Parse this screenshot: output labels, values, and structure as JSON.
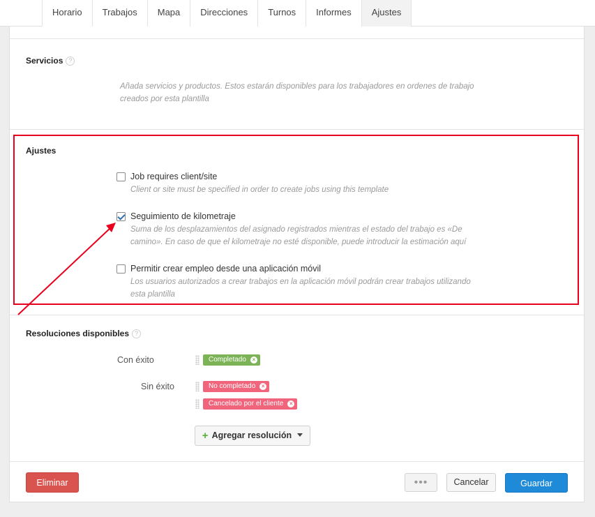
{
  "nav": {
    "tabs": [
      {
        "label": "Horario"
      },
      {
        "label": "Trabajos"
      },
      {
        "label": "Mapa"
      },
      {
        "label": "Direcciones"
      },
      {
        "label": "Turnos"
      },
      {
        "label": "Informes"
      },
      {
        "label": "Ajustes",
        "active": true
      }
    ]
  },
  "services": {
    "title": "Servicios",
    "help": "?",
    "hint": "Añada servicios y productos. Estos estarán disponibles para los trabajadores en ordenes de trabajo creados por esta plantilla"
  },
  "settings": {
    "title": "Ajustes",
    "options": [
      {
        "label": "Job requires client/site",
        "checked": false,
        "description": "Client or site must be specified in order to create jobs using this template"
      },
      {
        "label": "Seguimiento de kilometraje",
        "checked": true,
        "description": "Suma de los desplazamientos del asignado registrados mientras el estado del trabajo es «De camino». En caso de que el kilometraje no esté disponible, puede introducir la estimación aquí"
      },
      {
        "label": "Permitir crear empleo desde una aplicación móvil",
        "checked": false,
        "description": "Los usuarios autorizados a crear trabajos en la aplicación móvil podrán crear trabajos utilizando esta plantilla"
      }
    ]
  },
  "resolutions": {
    "title": "Resoluciones disponibles",
    "help": "?",
    "success_label": "Con éxito",
    "failure_label": "Sin éxito",
    "success_items": [
      "Completado"
    ],
    "failure_items": [
      "No completado",
      "Cancelado por el cliente"
    ],
    "remove_icon": "×",
    "add_button": "Agregar resolución",
    "add_icon": "+"
  },
  "footer": {
    "delete_button": "Eliminar",
    "more_button": "•••",
    "cancel_button": "Cancelar",
    "save_button": "Guardar"
  },
  "colors": {
    "success": "#7cb356",
    "failure": "#f0657b",
    "primary": "#1f8ad8",
    "danger": "#d9534f",
    "highlight": "#e8001c"
  }
}
